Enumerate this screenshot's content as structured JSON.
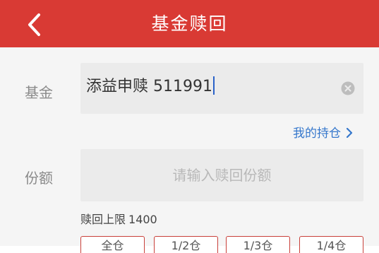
{
  "header": {
    "title": "基金赎回",
    "back_icon": "chevron-left-icon"
  },
  "form": {
    "fund_label": "基金",
    "fund_value": "添益申赎 511991",
    "clear_icon": "clear-circle-icon",
    "holdings_link": "我的持仓",
    "share_label": "份额",
    "share_placeholder": "请输入赎回份额",
    "limit_label": "赎回上限",
    "limit_value": "1400"
  },
  "quick_amounts": [
    "全仓",
    "1/2仓",
    "1/3仓",
    "1/4仓"
  ],
  "colors": {
    "header_bg": "#d93a34",
    "link": "#3577cc",
    "button_border": "#c9403a"
  }
}
